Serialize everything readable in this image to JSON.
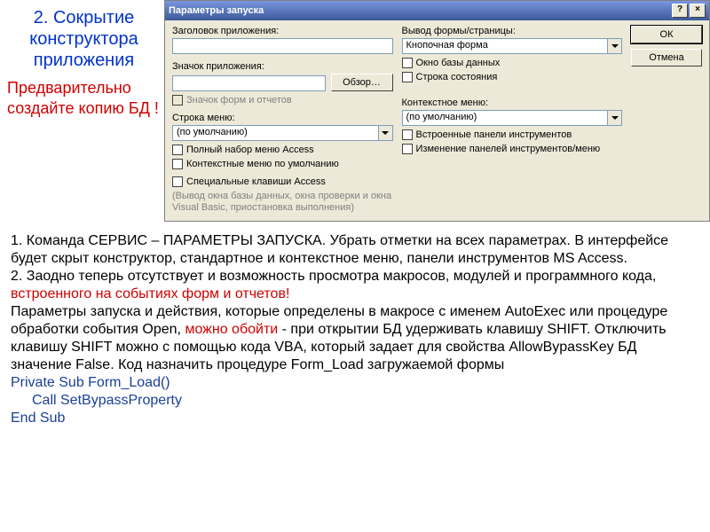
{
  "leftPanel": {
    "title": "2. Сокрытие конструктора приложения",
    "warn": "Предварительно создайте копию БД !"
  },
  "dialog": {
    "title": "Параметры запуска",
    "helpBtn": "?",
    "closeBtn": "×",
    "appTitleLabel": "Заголовок приложения:",
    "appIconLabel": "Значок приложения:",
    "browseBtn": "Обзор…",
    "iconFormsCheck": "Значок форм и отчетов",
    "menuRowLabel": "Строка меню:",
    "defaultOption": "(по умолчанию)",
    "fullMenu": "Полный набор меню Access",
    "ctxDefault": "Контекстные меню по умолчанию",
    "outputFormLabel": "Вывод формы/страницы:",
    "outputFormValue": "Кнопочная форма",
    "dbWindow": "Окно базы данных",
    "statusBar": "Строка состояния",
    "ctxMenuLabel": "Контекстное меню:",
    "builtinToolbars": "Встроенные панели инструментов",
    "toolbarChanges": "Изменение панелей инструментов/меню",
    "specialKeys": "Специальные клавиши Access",
    "footnote": "(Вывод окна базы данных, окна проверки и окна Visual Basic, приостановка выполнения)",
    "ok": "ОК",
    "cancel": "Отмена"
  },
  "body": {
    "p1a": "1. Команда СЕРВИС – ПАРАМЕТРЫ ЗАПУСКА. Убрать отметки на всех параметрах. В интерфейсе будет скрыт конструктор,  стандартное и контекстное меню, панели инструментов MS Access.",
    "p2a": "2. Заодно теперь отсутствует и возможность просмотра макросов, модулей и программного кода, ",
    "p2red": "встроенного на событиях форм и отчетов!",
    "p3a": "Параметры запуска и действия, которые определены в макросе с именем AutoExec или процедуре обработки события Open, ",
    "p3red": "можно обойти",
    "p3b": " - при открытии БД удерживать клавишу SHIFT. Отключить клавишу SHIFT можно с помощью кода VBA, который задает для свойства AllowBypassKey БД значение False. Код назначить процедуре Form_Load загружаемой формы",
    "code1": "Private Sub Form_Load()",
    "code2": "Call SetBypassProperty",
    "code3": "End Sub"
  }
}
